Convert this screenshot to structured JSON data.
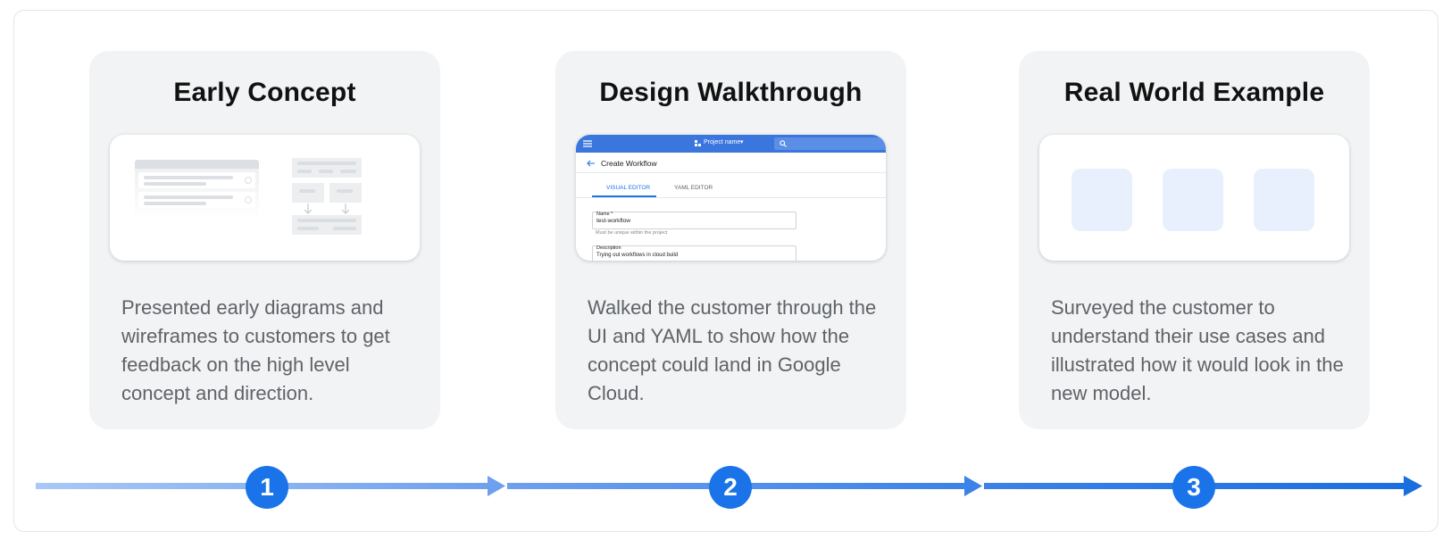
{
  "steps": [
    {
      "number": "1",
      "title": "Early Concept",
      "description": "Presented early diagrams and wireframes to customers to get feedback on the high level concept and direction."
    },
    {
      "number": "2",
      "title": "Design Walkthrough",
      "description": "Walked the customer through the UI and YAML to show how the concept could land in Google Cloud.",
      "ui_preview": {
        "project_selector": "Project name",
        "page_title": "Create Workflow",
        "tabs": [
          "VISUAL EDITOR",
          "YAML EDITOR"
        ],
        "name_label": "Name *",
        "name_value": "test-workflow",
        "name_hint": "Must be unique within the project",
        "description_label": "Description",
        "description_value": "Trying out workflows in cloud build"
      }
    },
    {
      "number": "3",
      "title": "Real World Example",
      "description": "Surveyed the customer to understand their use cases and illustrated how it would look in the new model."
    }
  ],
  "colors": {
    "accent": "#1a73e8",
    "timeline_start": "#a9c8f6",
    "timeline_end": "#1a6fdf",
    "card_bg": "#f1f3f4",
    "description_text": "#5f6368"
  },
  "icons": [
    "menu-icon",
    "search-icon",
    "back-arrow-icon",
    "dropdown-icon",
    "arrow-right-icon"
  ]
}
